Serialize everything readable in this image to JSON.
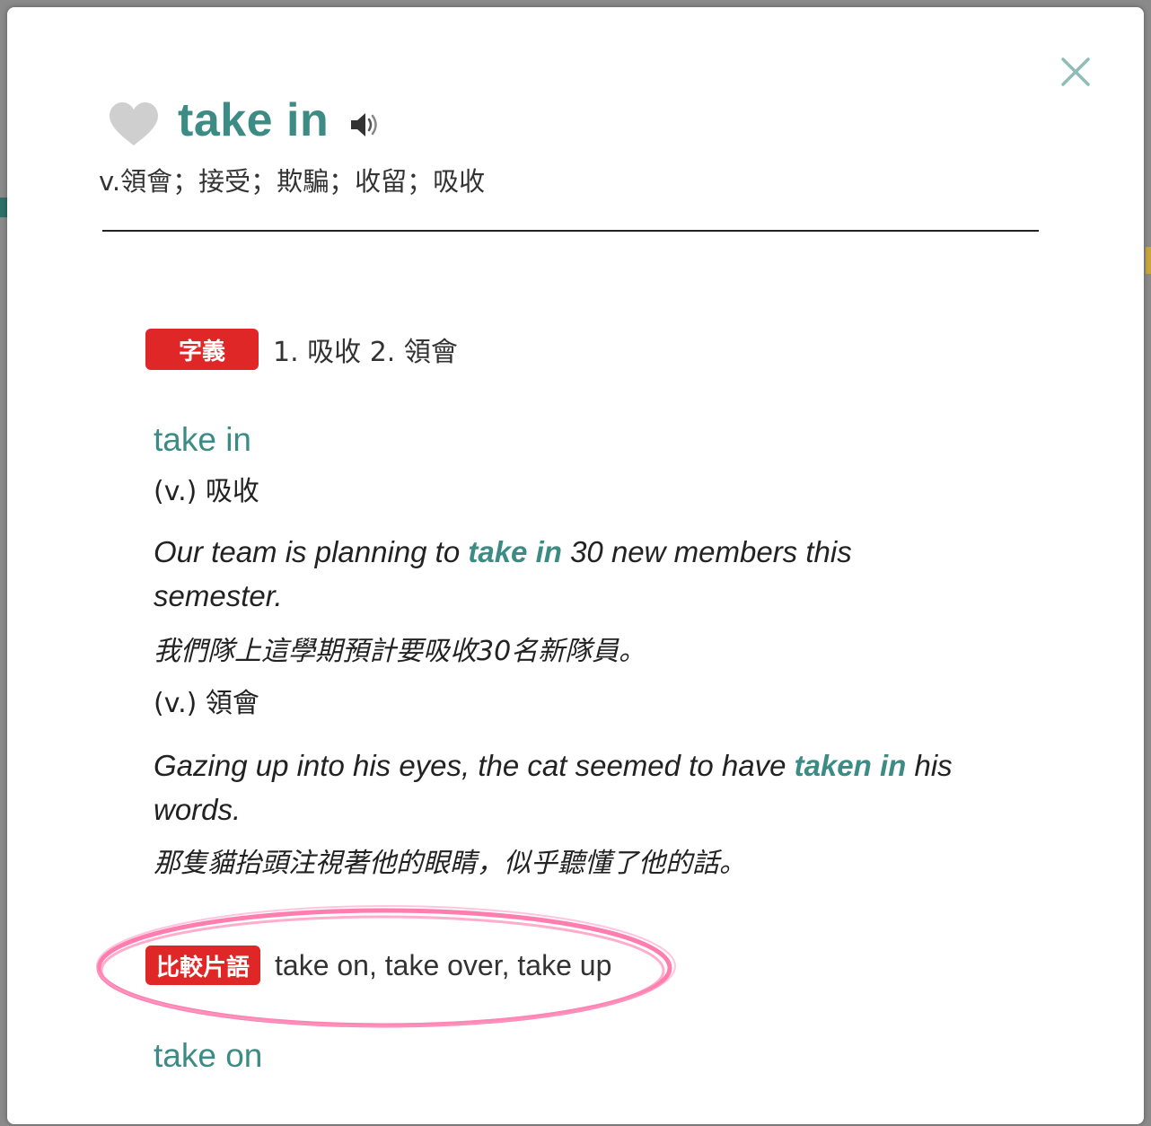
{
  "entry": {
    "word": "take in",
    "summary": "v.領會；接受；欺騙；收留；吸收"
  },
  "meanings": {
    "badge": "字義",
    "text": "1. 吸收 2. 領會"
  },
  "phrase": {
    "title": "take in",
    "senses": [
      {
        "pos": "(v.) 吸收",
        "example_before": "Our team is planning to ",
        "example_highlight": "take in",
        "example_after": " 30 new members this semester.",
        "translation": "我們隊上這學期預計要吸收30名新隊員。"
      },
      {
        "pos": "(v.) 領會",
        "example_before": "Gazing up into his eyes, the cat seemed to have ",
        "example_highlight": "taken in",
        "example_after": " his words.",
        "translation": "那隻貓抬頭注視著他的眼睛，似乎聽懂了他的話。"
      }
    ]
  },
  "compare": {
    "badge": "比較片語",
    "text": "take on, take over, take up"
  },
  "next_entry": {
    "title": "take on"
  },
  "icons": {
    "close": "close-icon",
    "favorite": "heart-icon",
    "audio": "speaker-icon"
  },
  "colors": {
    "accent": "#3d8b85",
    "badge": "#e02727",
    "annotation": "#ff6fa6",
    "heart": "#cfcfcf"
  }
}
